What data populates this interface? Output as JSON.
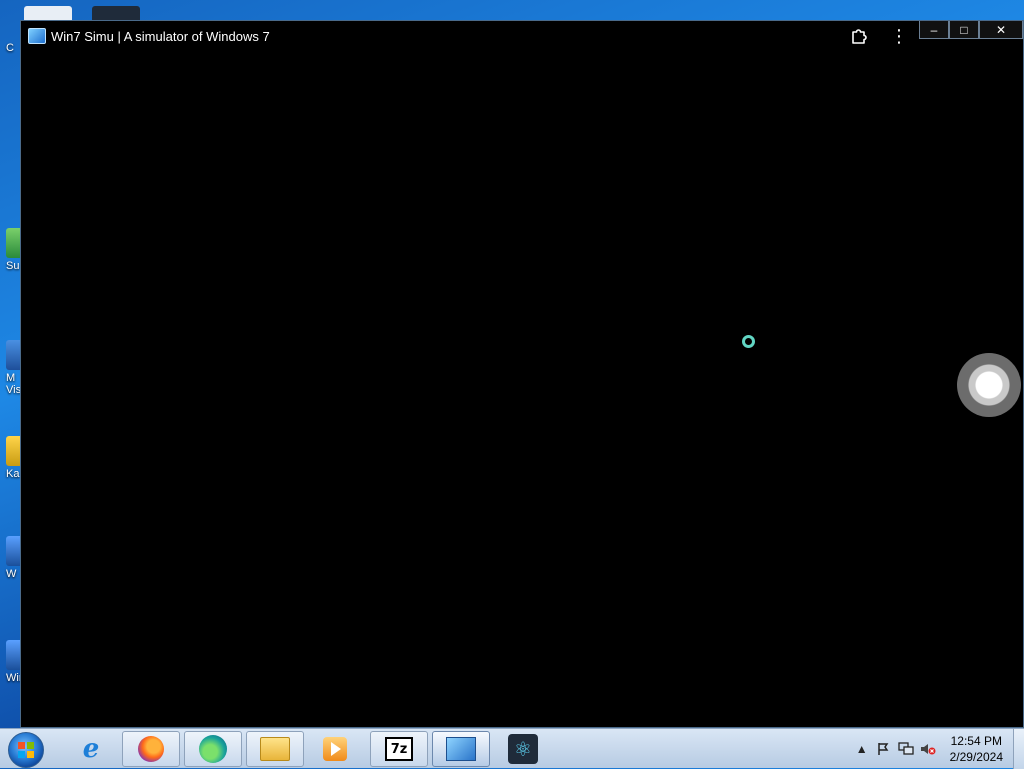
{
  "window": {
    "title": "Win7 Simu | A simulator of Windows 7",
    "app_icon": "win7-simu-icon",
    "buttons": {
      "extension": "puzzle-icon",
      "more": "⋮",
      "minimize": "–",
      "maximize": "□",
      "close": "✕"
    }
  },
  "content": {
    "loading_indicator": "spinner-icon",
    "assistive_touch": "assistive-touch-icon"
  },
  "desktop": {
    "icon_labels": [
      "C",
      "Su",
      "M\nVis",
      "Ka",
      "W",
      "Wir"
    ]
  },
  "taskbar": {
    "start": "start-button",
    "pinned": [
      "internet-explorer",
      "firefox",
      "edge",
      "file-explorer",
      "media-player",
      "7-zip",
      "win7-simu",
      "react-app"
    ],
    "sevenzip_label": "7z",
    "tray": {
      "show_hidden": "▲",
      "time": "12:54 PM",
      "date": "2/29/2024"
    }
  },
  "colors": {
    "spinner": "#62d6c4",
    "window_bg": "#000000",
    "taskbar": "#c8d9ec"
  }
}
